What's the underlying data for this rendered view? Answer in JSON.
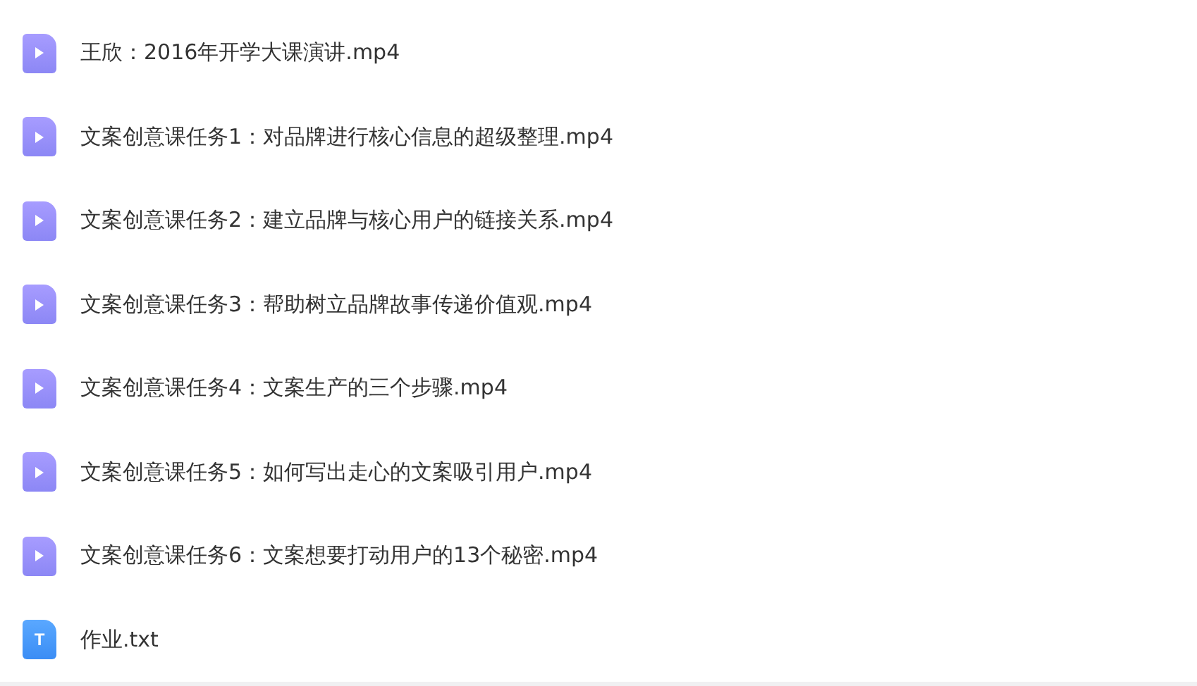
{
  "files": [
    {
      "kind": "video",
      "name": "王欣：2016年开学大课演讲.mp4"
    },
    {
      "kind": "video",
      "name": "文案创意课任务1：对品牌进行核心信息的超级整理.mp4"
    },
    {
      "kind": "video",
      "name": "文案创意课任务2：建立品牌与核心用户的链接关系.mp4"
    },
    {
      "kind": "video",
      "name": "文案创意课任务3：帮助树立品牌故事传递价值观.mp4"
    },
    {
      "kind": "video",
      "name": "文案创意课任务4：文案生产的三个步骤.mp4"
    },
    {
      "kind": "video",
      "name": "文案创意课任务5：如何写出走心的文案吸引用户.mp4"
    },
    {
      "kind": "video",
      "name": "文案创意课任务6：文案想要打动用户的13个秘密.mp4"
    },
    {
      "kind": "text",
      "name": "作业.txt",
      "badge": "T"
    }
  ]
}
